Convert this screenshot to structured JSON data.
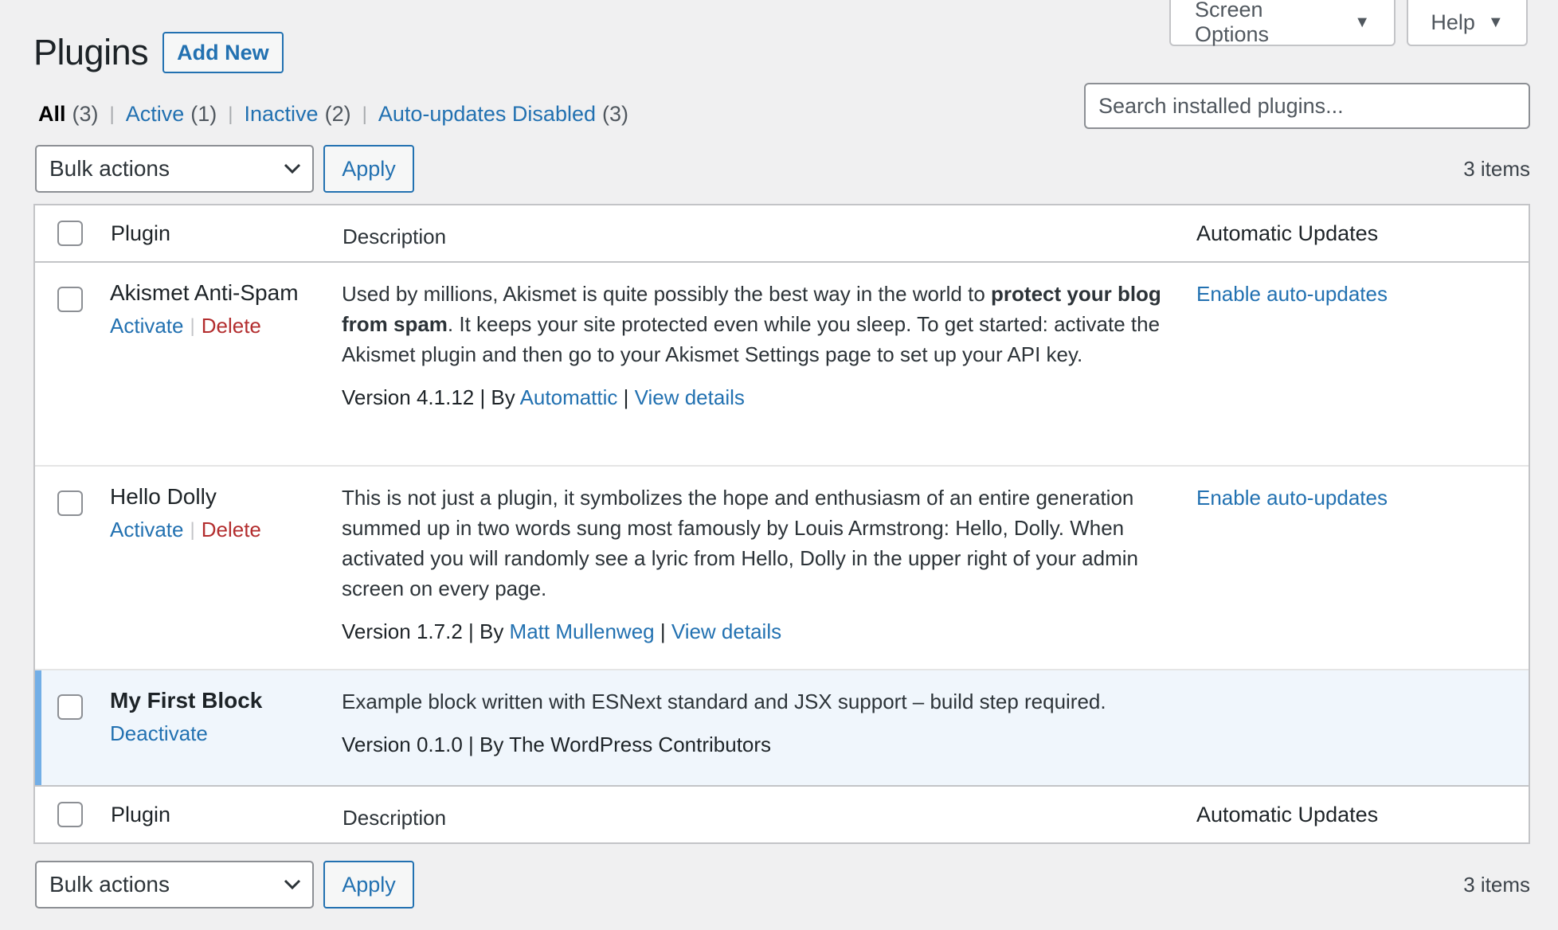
{
  "screen_meta": {
    "screen_options_label": "Screen Options",
    "help_label": "Help",
    "dropdown_glyph": "▼"
  },
  "header": {
    "title": "Plugins",
    "add_new_label": "Add New"
  },
  "filters": [
    {
      "label": "All",
      "count": "(3)",
      "current": true
    },
    {
      "label": "Active",
      "count": "(1)",
      "current": false
    },
    {
      "label": "Inactive",
      "count": "(2)",
      "current": false
    },
    {
      "label": "Auto-updates Disabled",
      "count": "(3)",
      "current": false
    }
  ],
  "filter_separator": "|",
  "search": {
    "placeholder": "Search installed plugins...",
    "value": ""
  },
  "tablenav": {
    "bulk_actions_label": "Bulk actions",
    "apply_label": "Apply",
    "items_count": "3 items"
  },
  "columns": {
    "plugin": "Plugin",
    "description": "Description",
    "auto_updates": "Automatic Updates"
  },
  "plugins": [
    {
      "name": "Akismet Anti-Spam",
      "active": false,
      "actions": [
        {
          "label": "Activate",
          "type": "activate"
        },
        {
          "label": "Delete",
          "type": "delete"
        }
      ],
      "description_before": "Used by millions, Akismet is quite possibly the best way in the world to ",
      "description_bold": "protect your blog from spam",
      "description_after": ". It keeps your site protected even while you sleep. To get started: activate the Akismet plugin and then go to your Akismet Settings page to set up your API key.",
      "version_text": "Version 4.1.12 | By ",
      "author": "Automattic",
      "details_sep": " | ",
      "details_label": "View details",
      "auto_update_label": "Enable auto-updates"
    },
    {
      "name": "Hello Dolly",
      "active": false,
      "actions": [
        {
          "label": "Activate",
          "type": "activate"
        },
        {
          "label": "Delete",
          "type": "delete"
        }
      ],
      "description_before": "This is not just a plugin, it symbolizes the hope and enthusiasm of an entire generation summed up in two words sung most famously by Louis Armstrong: Hello, Dolly. When activated you will randomly see a lyric from Hello, Dolly in the upper right of your admin screen on every page.",
      "description_bold": "",
      "description_after": "",
      "version_text": "Version 1.7.2 | By ",
      "author": "Matt Mullenweg",
      "details_sep": " | ",
      "details_label": "View details",
      "auto_update_label": "Enable auto-updates"
    },
    {
      "name": "My First Block",
      "active": true,
      "actions": [
        {
          "label": "Deactivate",
          "type": "deactivate"
        }
      ],
      "description_before": "Example block written with ESNext standard and JSX support – build step required.",
      "description_bold": "",
      "description_after": "",
      "version_text": "Version 0.1.0 | By The WordPress Contributors",
      "author": "",
      "details_sep": "",
      "details_label": "",
      "auto_update_label": ""
    }
  ],
  "colors": {
    "link": "#2271b1",
    "delete": "#b32d2e",
    "active_row_bg": "#f0f6fc",
    "active_row_border": "#72aee6",
    "page_bg": "#f0f0f1"
  }
}
